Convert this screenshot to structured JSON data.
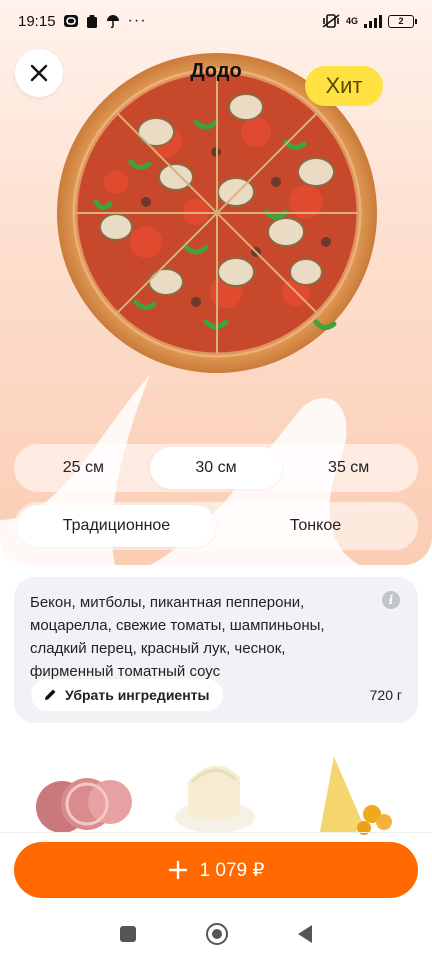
{
  "status_bar": {
    "time": "19:15",
    "network": "4G",
    "battery": "2"
  },
  "product": {
    "title": "Додо",
    "badge": "Хит"
  },
  "size_options": [
    {
      "label": "25 см",
      "selected": false
    },
    {
      "label": "30 см",
      "selected": true
    },
    {
      "label": "35 см",
      "selected": false
    }
  ],
  "dough_options": [
    {
      "label": "Традиционное",
      "selected": true
    },
    {
      "label": "Тонкое",
      "selected": false
    }
  ],
  "ingredients": {
    "description": "Бекон, митболы, пикантная пепперони, моцарелла, свежие томаты, шампиньоны, сладкий перец, красный лук, чеснок, фирменный томатный соус",
    "remove_label": "Убрать ингредиенты",
    "weight": "720 г"
  },
  "cart": {
    "price": "1 079 ₽"
  },
  "colors": {
    "accent": "#ff6900",
    "badge": "#ffe141",
    "hero_bg": "#fbcdb4",
    "card_bg": "#f1f2f6"
  },
  "icons": {
    "close": "close-icon",
    "info": "info-icon",
    "pencil": "pencil-icon",
    "plus": "plus-icon"
  }
}
